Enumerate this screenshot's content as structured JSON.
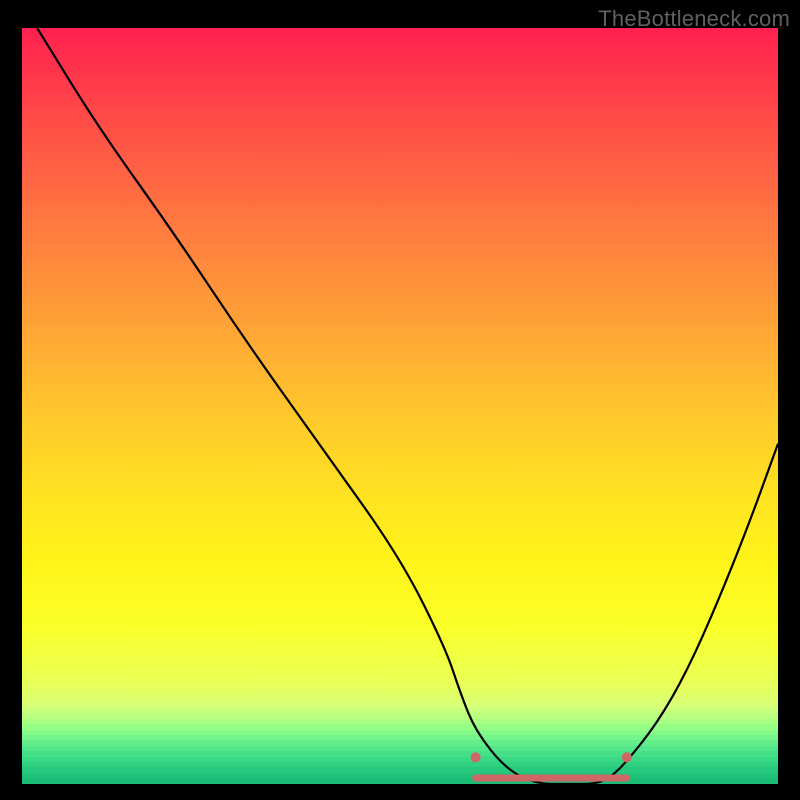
{
  "watermark": "TheBottleneck.com",
  "chart_data": {
    "type": "line",
    "title": "",
    "xlabel": "",
    "ylabel": "",
    "xlim": [
      0,
      100
    ],
    "ylim": [
      0,
      100
    ],
    "grid": false,
    "legend": false,
    "series": [
      {
        "name": "bottleneck-curve",
        "x": [
          2,
          10,
          20,
          30,
          40,
          50,
          56,
          58,
          60,
          64,
          68,
          72,
          76,
          78,
          80,
          84,
          88,
          92,
          96,
          100
        ],
        "y": [
          100,
          87,
          73,
          58,
          44,
          30,
          18,
          12,
          7,
          2,
          0,
          0,
          0,
          1,
          3,
          8,
          15,
          24,
          34,
          45
        ]
      }
    ],
    "highlight_segment": {
      "x_start": 60,
      "x_end": 80,
      "y": 0
    },
    "annotations": [
      {
        "kind": "dot",
        "x": 60,
        "y": 3
      },
      {
        "kind": "dot",
        "x": 80,
        "y": 3
      }
    ],
    "background": {
      "gradient_top_color": "#ff2050",
      "gradient_mid_color": "#ffe122",
      "gradient_bottom_color": "#d6ff7a",
      "band_colors": [
        "#caff7e",
        "#b9ff80",
        "#a8ff82",
        "#96fd85",
        "#85fa88",
        "#74f48a",
        "#63ed8b",
        "#54e68a",
        "#46df88",
        "#39d885",
        "#2fd181",
        "#27ca7d",
        "#20c379",
        "#1bbd76"
      ]
    }
  }
}
